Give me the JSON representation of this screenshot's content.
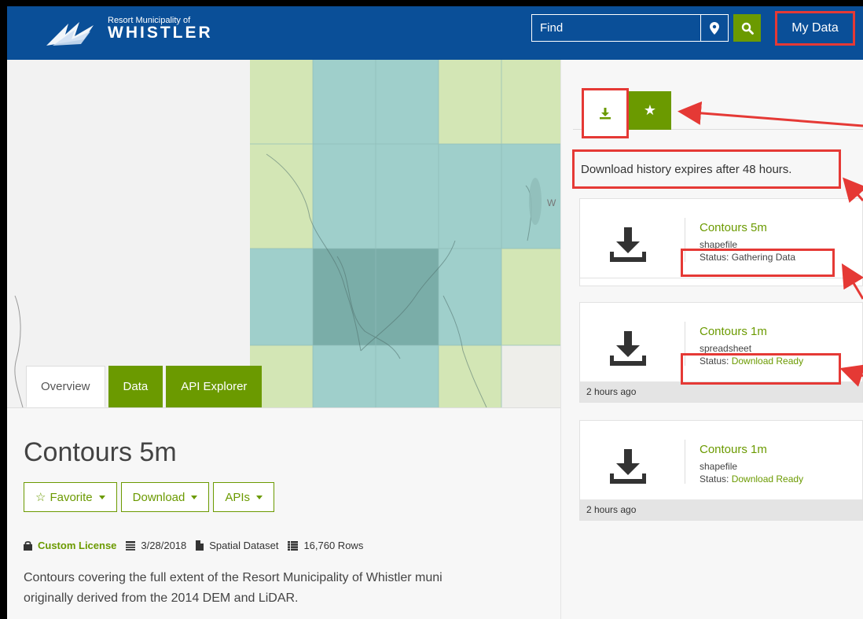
{
  "header": {
    "logo_small": "Resort Municipality of",
    "logo_big": "WHISTLER",
    "find_placeholder": "Find",
    "my_data_label": "My Data"
  },
  "map": {
    "label": "W"
  },
  "tabs": [
    {
      "label": "Overview"
    },
    {
      "label": "Data"
    },
    {
      "label": "API Explorer"
    }
  ],
  "dataset": {
    "title": "Contours 5m",
    "buttons": {
      "favorite": "Favorite",
      "download": "Download",
      "apis": "APIs"
    },
    "license": "Custom License",
    "date": "3/28/2018",
    "type": "Spatial Dataset",
    "rows": "16,760 Rows",
    "description_line1": "Contours covering the full extent of the Resort Municipality of Whistler muni",
    "description_line2": "originally derived from the 2014 DEM and LiDAR."
  },
  "panel": {
    "expire_note": "Download history expires after 48 hours.",
    "downloads": [
      {
        "name": "Contours 5m",
        "format": "shapefile",
        "status_prefix": "Status: ",
        "status": "Gathering Data",
        "age": ""
      },
      {
        "name": "Contours 1m",
        "format": "spreadsheet",
        "status_prefix": "Status: ",
        "status": "Download Ready",
        "age": "2 hours ago"
      },
      {
        "name": "Contours 1m",
        "format": "shapefile",
        "status_prefix": "Status: ",
        "status": "Download Ready",
        "age": "2 hours ago"
      }
    ]
  },
  "colors": {
    "header_blue": "#0a4f98",
    "accent_green": "#6b9a00",
    "annotation_red": "#e53935"
  }
}
